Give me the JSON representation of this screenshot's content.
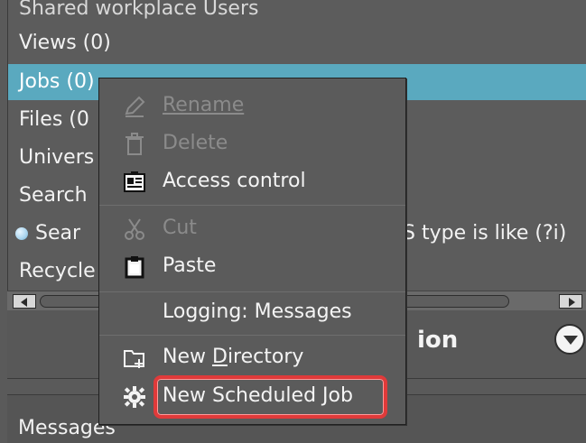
{
  "tree": {
    "items": [
      {
        "label": "Shared workplace Users"
      },
      {
        "label": "Views (0)"
      },
      {
        "label": "Jobs (0)"
      },
      {
        "label": "Files (0"
      },
      {
        "label": "Univers"
      },
      {
        "label": "Search"
      },
      {
        "label": "Sear"
      },
      {
        "label": "Recycle"
      }
    ],
    "search_right_text": "S type is like (?i)"
  },
  "props": {
    "title_fragment": "ion"
  },
  "messages": {
    "label": "Messages"
  },
  "context_menu": {
    "rename": "Rename",
    "delete": "Delete",
    "access_control": "Access control",
    "cut": "Cut",
    "paste": "Paste",
    "logging": "Logging: Messages",
    "new_directory_pre": "New ",
    "new_directory_ul": "D",
    "new_directory_post": "irectory",
    "new_scheduled_job": "New Scheduled Job"
  },
  "colors": {
    "selection": "#5aa9bf",
    "highlight_border": "#e03a3a"
  }
}
